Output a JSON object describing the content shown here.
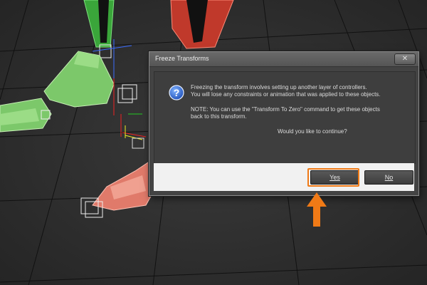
{
  "dialog": {
    "title": "Freeze Transforms",
    "close_label": "✕",
    "message_lines": [
      "Freezing the transform involves setting up another layer of controllers.",
      "You will lose any constraints or animation that was applied to these objects.",
      "NOTE: You can use the \"Transform To Zero\" command to get these objects",
      "back to this transform.",
      "Would you like to continue?"
    ],
    "yes_label": "Yes",
    "no_label": "No",
    "icon": "question-icon"
  },
  "colors": {
    "highlight": "#f07a16",
    "dialog_bg": "#434343",
    "button_bar": "#f1f1f1"
  }
}
